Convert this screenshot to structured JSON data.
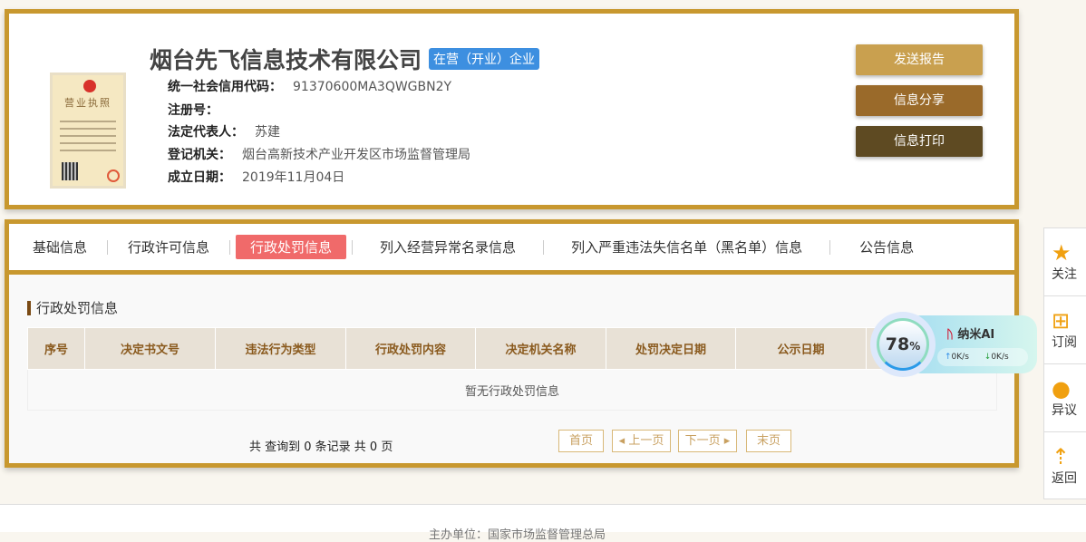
{
  "company": {
    "name": "烟台先飞信息技术有限公司",
    "status": "在营（开业）企业",
    "fields": [
      {
        "label": "统一社会信用代码：",
        "value": "91370600MA3QWGBN2Y"
      },
      {
        "label": "注册号：",
        "value": ""
      },
      {
        "label": "法定代表人：",
        "value": "苏建"
      },
      {
        "label": "登记机关：",
        "value": "烟台高新技术产业开发区市场监督管理局"
      },
      {
        "label": "成立日期：",
        "value": "2019年11月04日"
      }
    ],
    "license_title": "营业执照"
  },
  "actions": {
    "send": "发送报告",
    "share": "信息分享",
    "print": "信息打印"
  },
  "tabs": [
    "基础信息",
    "行政许可信息",
    "行政处罚信息",
    "列入经营异常名录信息",
    "列入严重违法失信名单（黑名单）信息",
    "公告信息"
  ],
  "section": {
    "title": "行政处罚信息",
    "columns": [
      "序号",
      "决定书文号",
      "违法行为类型",
      "行政处罚内容",
      "决定机关名称",
      "处罚决定日期",
      "公示日期",
      ""
    ],
    "empty": "暂无行政处罚信息"
  },
  "pager": {
    "summary": "共 查询到 0 条记录 共 0 页",
    "first": "首页",
    "prev": "上一页",
    "next": "下一页",
    "last": "末页"
  },
  "sidebar": [
    "关注",
    "订阅",
    "异议",
    "返回"
  ],
  "widget": {
    "percent": "78",
    "name": "纳米AI",
    "up": "0K/s",
    "down": "0K/s"
  },
  "footer": "主办单位：国家市场监督管理总局"
}
